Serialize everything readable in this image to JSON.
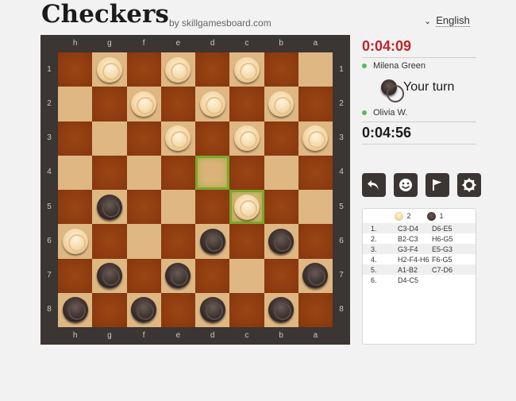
{
  "header": {
    "title": "Checkers",
    "byline": "by skillgamesboard.com",
    "language": "English"
  },
  "board": {
    "files": [
      "h",
      "g",
      "f",
      "e",
      "d",
      "c",
      "b",
      "a"
    ],
    "ranks": [
      "1",
      "2",
      "3",
      "4",
      "5",
      "6",
      "7",
      "8"
    ],
    "pieces": [
      {
        "row": 1,
        "col": 2,
        "color": "white"
      },
      {
        "row": 1,
        "col": 4,
        "color": "white"
      },
      {
        "row": 1,
        "col": 6,
        "color": "white"
      },
      {
        "row": 2,
        "col": 3,
        "color": "white"
      },
      {
        "row": 2,
        "col": 5,
        "color": "white"
      },
      {
        "row": 2,
        "col": 7,
        "color": "white"
      },
      {
        "row": 3,
        "col": 4,
        "color": "white"
      },
      {
        "row": 3,
        "col": 6,
        "color": "white"
      },
      {
        "row": 3,
        "col": 8,
        "color": "white"
      },
      {
        "row": 5,
        "col": 2,
        "color": "black"
      },
      {
        "row": 5,
        "col": 6,
        "color": "white"
      },
      {
        "row": 6,
        "col": 1,
        "color": "white"
      },
      {
        "row": 6,
        "col": 5,
        "color": "black"
      },
      {
        "row": 6,
        "col": 7,
        "color": "black"
      },
      {
        "row": 7,
        "col": 2,
        "color": "black"
      },
      {
        "row": 7,
        "col": 4,
        "color": "black"
      },
      {
        "row": 7,
        "col": 8,
        "color": "black"
      },
      {
        "row": 8,
        "col": 1,
        "color": "black"
      },
      {
        "row": 8,
        "col": 3,
        "color": "black"
      },
      {
        "row": 8,
        "col": 5,
        "color": "black"
      },
      {
        "row": 8,
        "col": 7,
        "color": "black"
      }
    ],
    "highlights": [
      {
        "row": 4,
        "col": 5
      },
      {
        "row": 5,
        "col": 6
      }
    ],
    "colors": {
      "light": "#dfb783",
      "dark": "#8e3b10",
      "highlight": "#7ea52b"
    }
  },
  "players": {
    "top": {
      "name": "Milena Green",
      "timer": "0:04:09",
      "timer_color": "#c0242b",
      "online": true
    },
    "bottom": {
      "name": "Olivia W.",
      "timer": "0:04:56",
      "online": true
    },
    "turn_label": "Your turn"
  },
  "controls": {
    "buttons": [
      "undo-icon",
      "smiley-icon",
      "flag-icon",
      "gear-icon"
    ]
  },
  "moves": {
    "white_count": "2",
    "black_count": "1",
    "rows": [
      {
        "n": "1.",
        "w": "C3-D4",
        "b": "D6-E5"
      },
      {
        "n": "2.",
        "w": "B2-C3",
        "b": "H6-G5"
      },
      {
        "n": "3.",
        "w": "G3-F4",
        "b": "E5-G3"
      },
      {
        "n": "4.",
        "w": "H2-F4-H6",
        "b": "F6-G5"
      },
      {
        "n": "5.",
        "w": "A1-B2",
        "b": "C7-D6"
      },
      {
        "n": "6.",
        "w": "D4-C5",
        "b": ""
      }
    ]
  }
}
